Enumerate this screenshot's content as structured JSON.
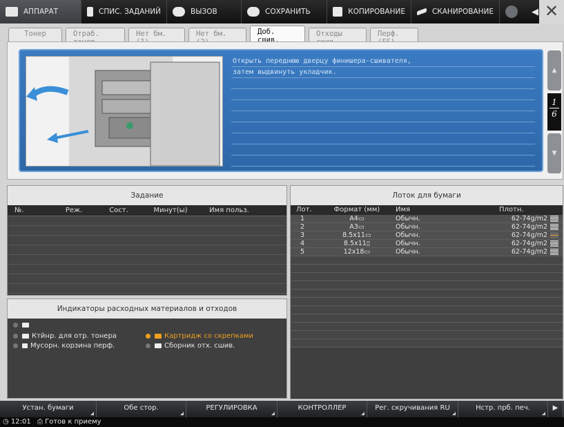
{
  "topbar": {
    "items": [
      {
        "label": "АППАРАТ",
        "icon": "machine-icon",
        "active": true
      },
      {
        "label": "СПИС. ЗАДАНИЙ",
        "icon": "list-icon"
      },
      {
        "label": "ВЫЗОВ",
        "icon": "recall-icon"
      },
      {
        "label": "СОХРАНИТЬ",
        "icon": "save-icon"
      },
      {
        "label": "КОПИРОВАНИЕ",
        "icon": "copy-icon"
      },
      {
        "label": "СКАНИРОВАНИЕ",
        "icon": "scan-icon"
      }
    ]
  },
  "tabs": [
    {
      "label": "Тонер",
      "active": false
    },
    {
      "label": "Отраб. тонер",
      "active": false
    },
    {
      "label": "Нет бм.(1)",
      "active": false
    },
    {
      "label": "Нет бм.(2)",
      "active": false
    },
    {
      "label": "Доб. сшив.",
      "active": true
    },
    {
      "label": "Отходы сшив.",
      "active": false
    },
    {
      "label": "Перф.(FS)",
      "active": false
    }
  ],
  "guide": {
    "lines": [
      "Открыть переднюю дверцу финишера-сшивателя,",
      "затем выдвинуть укладчик.",
      "",
      "",
      "",
      "",
      "",
      "",
      "",
      ""
    ],
    "page_current": "1",
    "page_total": "6",
    "up_symbol": "▲",
    "down_symbol": "▼"
  },
  "jobs": {
    "title": "Задание",
    "columns": [
      "№.",
      "Реж.",
      "Сост.",
      "Минут(ы)",
      "Имя польз."
    ],
    "rows": 8
  },
  "consumables": {
    "title": "Индикаторы расходных материалов и отходов",
    "items": [
      {
        "label": "",
        "icon": "toner-icon",
        "warn": false
      },
      {
        "label": "Ктйнр. для отр. тонера",
        "icon": "waste-toner-icon",
        "warn": false
      },
      {
        "label": "Мусорн. корзина перф.",
        "icon": "punch-waste-icon",
        "warn": false
      },
      {
        "label": "Картридж со скрепками",
        "icon": "staple-icon",
        "warn": true
      },
      {
        "label": "Сборник отх. сшив.",
        "icon": "staple-waste-icon",
        "warn": false
      }
    ],
    "warn_color": "#f0a020"
  },
  "trays": {
    "title": "Лоток для бумаги",
    "columns": [
      "Лот.",
      "Формат (мм)",
      "Имя",
      "Плотн."
    ],
    "rows": [
      {
        "lot": "1",
        "format": "A4▭",
        "name": "Обычн.",
        "weight": "62-74g/m2",
        "level": "full"
      },
      {
        "lot": "2",
        "format": "A3▭",
        "name": "Обычн.",
        "weight": "62-74g/m2",
        "level": "full"
      },
      {
        "lot": "3",
        "format": "8.5x11▭",
        "name": "Обычн.",
        "weight": "62-74g/m2",
        "level": "low"
      },
      {
        "lot": "4",
        "format": "8.5x11▯",
        "name": "Обычн.",
        "weight": "62-74g/m2",
        "level": "full"
      },
      {
        "lot": "5",
        "format": "12x18▭",
        "name": "Обычн.",
        "weight": "62-74g/m2",
        "level": "full"
      }
    ],
    "empty_rows": 11
  },
  "bottom": {
    "buttons": [
      "Устан. бумаги",
      "Обе стор.",
      "РЕГУЛИРОВКА",
      "КОНТРОЛЛЕР",
      "Рег. скручивания RU",
      "Нстр. прб. печ."
    ]
  },
  "status": {
    "time": "12:01",
    "text": "Готов к приему"
  }
}
